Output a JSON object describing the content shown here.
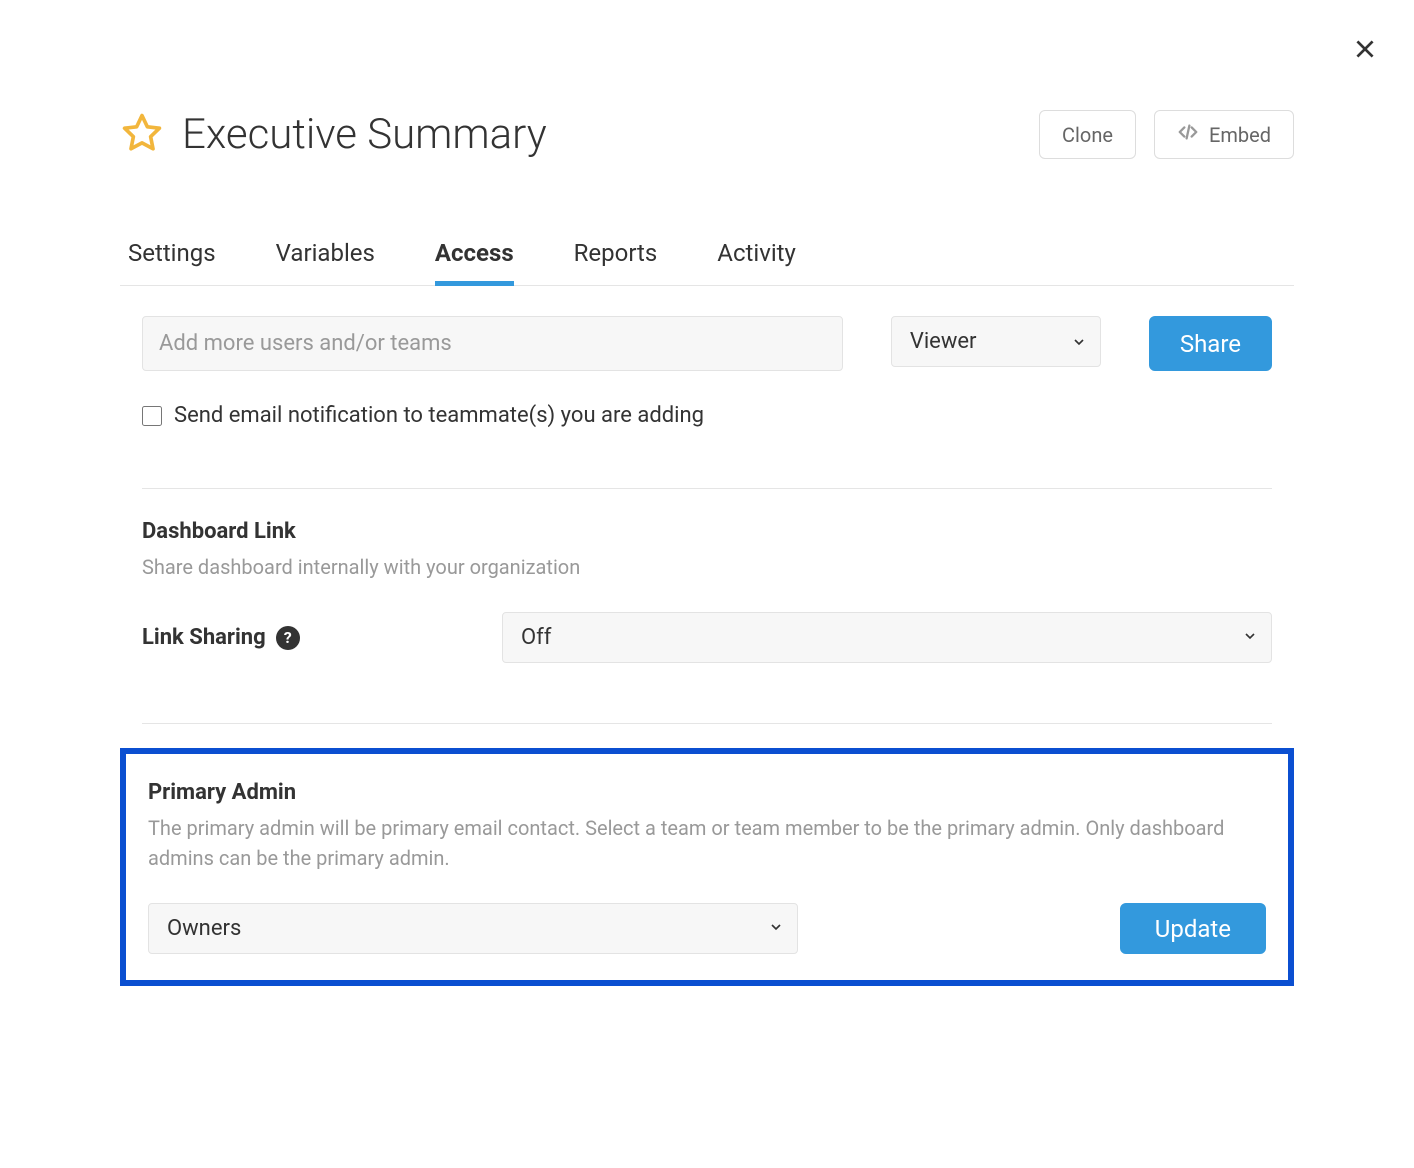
{
  "close": "×",
  "header": {
    "title": "Executive Summary",
    "clone": "Clone",
    "embed": "Embed"
  },
  "tabs": [
    "Settings",
    "Variables",
    "Access",
    "Reports",
    "Activity"
  ],
  "active_tab": "Access",
  "share": {
    "placeholder": "Add more users and/or teams",
    "role": "Viewer",
    "share_btn": "Share",
    "notify_label": "Send email notification to teammate(s) you are adding"
  },
  "dashboard_link": {
    "heading": "Dashboard Link",
    "desc": "Share dashboard internally with your organization",
    "label": "Link Sharing",
    "value": "Off"
  },
  "primary_admin": {
    "heading": "Primary Admin",
    "desc": "The primary admin will be primary email contact. Select a team or team member to be the primary admin. Only dashboard admins can be the primary admin.",
    "value": "Owners",
    "update": "Update"
  }
}
